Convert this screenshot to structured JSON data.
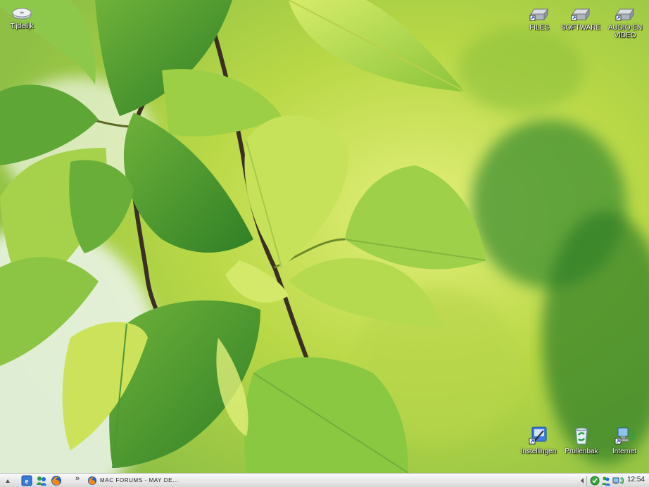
{
  "desktop": {
    "icons": [
      {
        "label": "Tijdelijk",
        "icon": "removable-drive-icon"
      },
      {
        "label": "FILES",
        "icon": "drive-shortcut-icon"
      },
      {
        "label": "SOFTWARE",
        "icon": "drive-shortcut-icon"
      },
      {
        "label": "AUDIO EN VIDEO",
        "icon": "drive-shortcut-icon"
      },
      {
        "label": "Instellingen",
        "icon": "control-panel-icon"
      },
      {
        "label": "Prullenbak",
        "icon": "recycle-bin-icon"
      },
      {
        "label": "Internet",
        "icon": "network-icon"
      }
    ]
  },
  "taskbar": {
    "quick_launch": [
      "ie-icon",
      "messenger-icon",
      "firefox-icon"
    ],
    "overflow": "»",
    "task": {
      "label": "MAC FORUMS - MAY DE...",
      "icon": "firefox-icon"
    },
    "clock": "12:54"
  },
  "colors": {
    "leaf_light": "#c9e35a",
    "leaf_dark": "#3f8f2a",
    "stem": "#3a2f22",
    "taskbar": "#e6e6e6"
  }
}
